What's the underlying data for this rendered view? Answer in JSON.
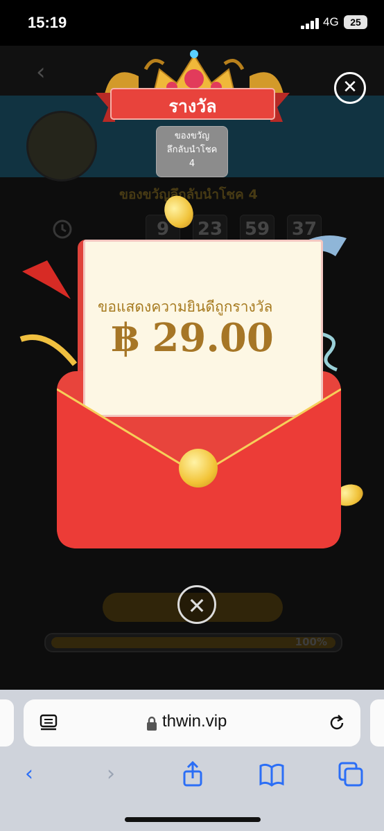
{
  "status_bar": {
    "time": "15:19",
    "network": "4G",
    "battery": "25"
  },
  "page": {
    "sub_label": "ของขวัญลึกลับนำโชค 4",
    "timer": [
      "9",
      "23",
      "59",
      "37"
    ],
    "progress": {
      "percent_text": "100%",
      "value": 1.0
    }
  },
  "modal": {
    "banner_title": "รางวัล",
    "badge": {
      "line1": "ของขวัญ",
      "line2": "ลึกลับนำโชค",
      "line3": "4"
    },
    "message": "ขอแสดงความยินดีถูกรางวัล",
    "amount": "฿ 29.00",
    "close_symbol": "✕"
  },
  "browser": {
    "url": "thwin.vip"
  },
  "colors": {
    "ribbon": "#e8433c",
    "envelope": "#ea3c37",
    "gold": "#f2c336",
    "accent_text": "#a67a1f",
    "ios_blue": "#2b6ef6"
  }
}
